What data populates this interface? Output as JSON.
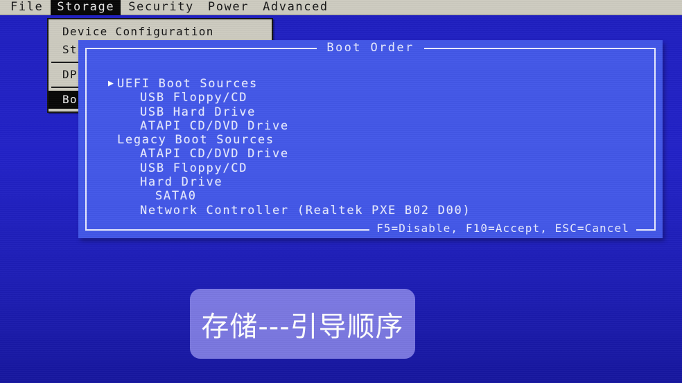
{
  "menubar": {
    "items": [
      {
        "label": "File",
        "active": false
      },
      {
        "label": "Storage",
        "active": true
      },
      {
        "label": "Security",
        "active": false
      },
      {
        "label": "Power",
        "active": false
      },
      {
        "label": "Advanced",
        "active": false
      }
    ]
  },
  "dropdown": {
    "items": [
      {
        "label": "Device Configuration",
        "selected": false,
        "separator_after": false
      },
      {
        "label": "St",
        "selected": false,
        "separator_after": true
      },
      {
        "label": "DP",
        "selected": false,
        "separator_after": true
      },
      {
        "label": "Bo",
        "selected": true,
        "separator_after": false
      }
    ]
  },
  "dialog": {
    "title": "Boot Order",
    "footer": "F5=Disable, F10=Accept, ESC=Cancel",
    "items": [
      {
        "label": "UEFI Boot Sources",
        "level": 0,
        "cursor": true
      },
      {
        "label": "USB Floppy/CD",
        "level": 1,
        "cursor": false
      },
      {
        "label": "USB Hard Drive",
        "level": 1,
        "cursor": false
      },
      {
        "label": "ATAPI CD/DVD Drive",
        "level": 1,
        "cursor": false
      },
      {
        "label": "Legacy Boot Sources",
        "level": 0,
        "cursor": false
      },
      {
        "label": "ATAPI CD/DVD Drive",
        "level": 1,
        "cursor": false
      },
      {
        "label": "USB Floppy/CD",
        "level": 1,
        "cursor": false
      },
      {
        "label": "Hard Drive",
        "level": 1,
        "cursor": false
      },
      {
        "label": "SATA0",
        "level": 2,
        "cursor": false
      },
      {
        "label": "Network Controller (Realtek PXE B02 D00)",
        "level": 1,
        "cursor": false
      }
    ]
  },
  "caption": {
    "text": "存储---引导顺序"
  },
  "colors": {
    "screen_background": "#1f1fc0",
    "menubar_background": "#cdcbc0",
    "menubar_highlight": "#060606",
    "dialog_background": "#4357e8",
    "dialog_border": "#e9ecff",
    "dialog_text": "#e6eaff",
    "caption_background": "#9692f0"
  }
}
